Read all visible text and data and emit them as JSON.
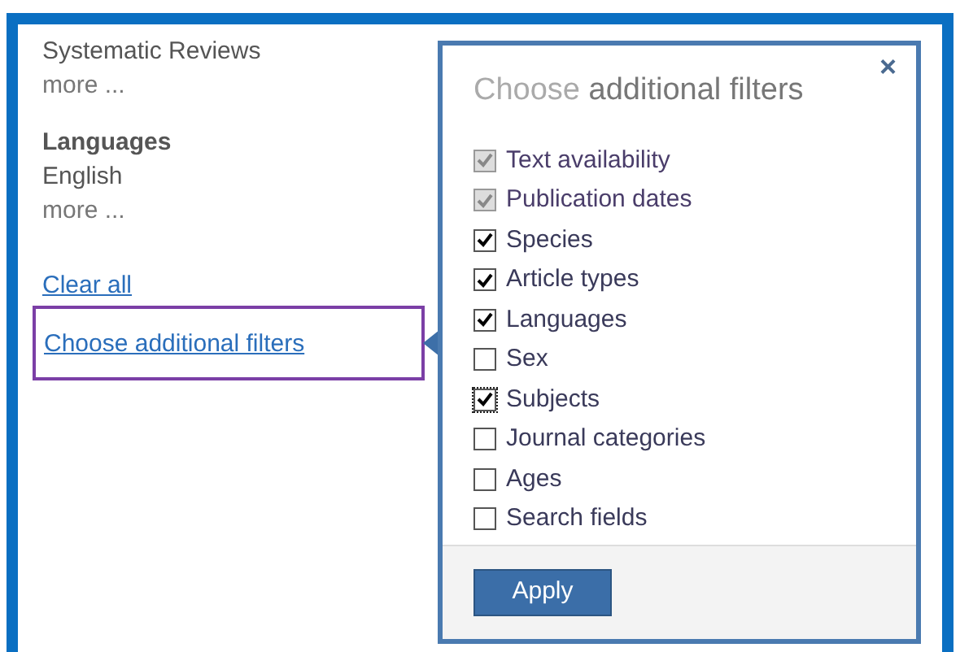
{
  "sidebar": {
    "items": [
      {
        "kind": "value",
        "text": "Systematic Reviews"
      },
      {
        "kind": "more",
        "text": "more ..."
      },
      {
        "kind": "heading",
        "text": "Languages"
      },
      {
        "kind": "value",
        "text": "English"
      },
      {
        "kind": "more",
        "text": "more ..."
      }
    ],
    "clear_link": "Clear all",
    "choose_link": {
      "text": "Choose additional filters",
      "highlighted": true
    }
  },
  "popup": {
    "title_prefix": "Choose",
    "title_rest": "additional filters",
    "close": "×",
    "filters": [
      {
        "label": "Text availability",
        "checked": true,
        "disabled": true,
        "focused": false
      },
      {
        "label": "Publication dates",
        "checked": true,
        "disabled": true,
        "focused": false
      },
      {
        "label": "Species",
        "checked": true,
        "disabled": false,
        "focused": false
      },
      {
        "label": "Article types",
        "checked": true,
        "disabled": false,
        "focused": false
      },
      {
        "label": "Languages",
        "checked": true,
        "disabled": false,
        "focused": false
      },
      {
        "label": "Sex",
        "checked": false,
        "disabled": false,
        "focused": false
      },
      {
        "label": "Subjects",
        "checked": true,
        "disabled": false,
        "focused": true
      },
      {
        "label": "Journal categories",
        "checked": false,
        "disabled": false,
        "focused": false
      },
      {
        "label": "Ages",
        "checked": false,
        "disabled": false,
        "focused": false
      },
      {
        "label": "Search fields",
        "checked": false,
        "disabled": false,
        "focused": false
      }
    ],
    "apply": "Apply"
  }
}
